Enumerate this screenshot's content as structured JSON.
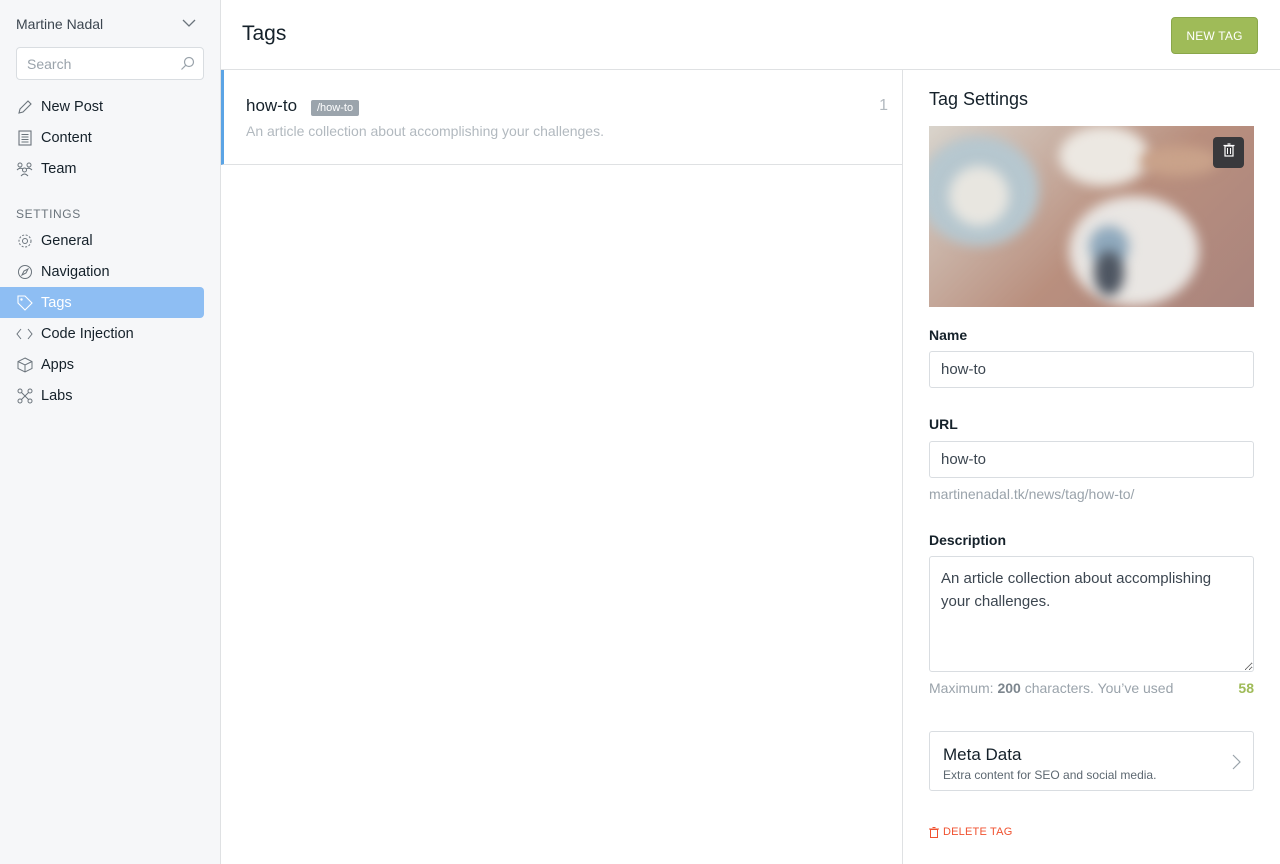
{
  "sidebar": {
    "user_name": "Martine Nadal",
    "search_placeholder": "Search",
    "main_items": [
      {
        "label": "New Post",
        "icon": "pen-icon"
      },
      {
        "label": "Content",
        "icon": "document-icon"
      },
      {
        "label": "Team",
        "icon": "team-icon"
      }
    ],
    "settings_heading": "SETTINGS",
    "settings_items": [
      {
        "label": "General",
        "icon": "gear-icon"
      },
      {
        "label": "Navigation",
        "icon": "compass-icon"
      },
      {
        "label": "Tags",
        "icon": "tag-icon",
        "active": true
      },
      {
        "label": "Code Injection",
        "icon": "code-icon"
      },
      {
        "label": "Apps",
        "icon": "box-icon"
      },
      {
        "label": "Labs",
        "icon": "labs-icon"
      }
    ]
  },
  "header": {
    "title": "Tags",
    "new_tag_label": "NEW TAG"
  },
  "tag_list": [
    {
      "name": "how-to",
      "slug": "/how-to",
      "description": "An article collection about accomplishing your challenges.",
      "count": "1"
    }
  ],
  "tag_settings": {
    "title": "Tag Settings",
    "name_label": "Name",
    "name_value": "how-to",
    "url_label": "URL",
    "url_value": "how-to",
    "url_hint": "martinenadal.tk/news/tag/how-to/",
    "description_label": "Description",
    "description_value": "An article collection about accomplishing your challenges.",
    "char_hint_prefix": "Maximum: ",
    "char_hint_max": "200",
    "char_hint_suffix": " characters. You’ve used",
    "char_used": "58",
    "meta_title": "Meta Data",
    "meta_subtitle": "Extra content for SEO and social media.",
    "delete_label": "DELETE TAG"
  },
  "colors": {
    "accent_green": "#9fbb58",
    "active_nav": "#8ebef3",
    "selected_border": "#5ba4e5",
    "danger": "#f05230"
  }
}
